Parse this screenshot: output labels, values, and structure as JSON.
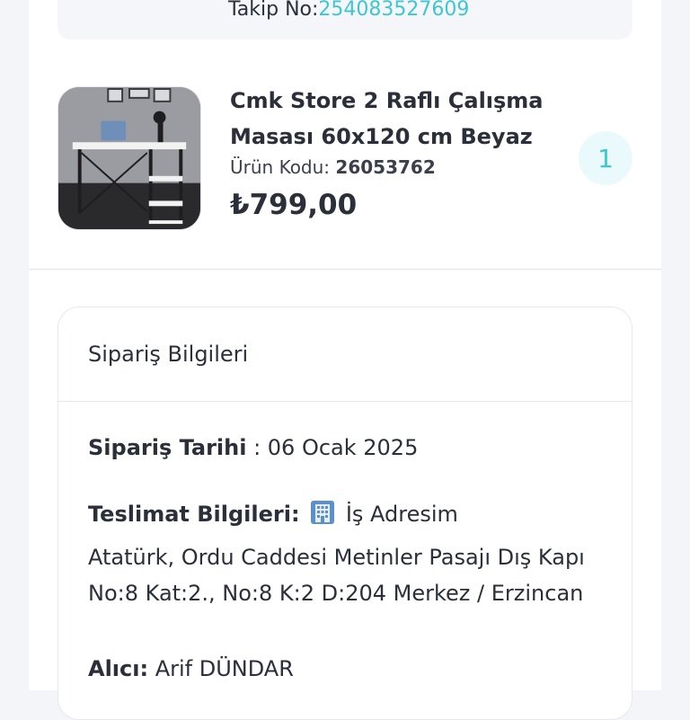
{
  "tracking": {
    "label": "Takip No:",
    "number": "254083527609"
  },
  "product": {
    "title": "Cmk Store 2 Raflı Çalışma Masası 60x120 cm Beyaz",
    "code_label": "Ürün Kodu:",
    "code_value": "26053762",
    "price": "₺799,00",
    "quantity": "1",
    "image_icon": "desk-product-image"
  },
  "order_info": {
    "header": "Sipariş Bilgileri",
    "date_label": "Sipariş Tarihi",
    "date_separator": " : ",
    "date_value": "06 Ocak 2025",
    "delivery_label": "Teslimat Bilgileri:",
    "delivery_icon": "building-icon",
    "delivery_address_name": "İş Adresim",
    "address": "Atatürk, Ordu Caddesi Metinler Pasajı Dış Kapı No:8 Kat:2., No:8 K:2 D:204 Merkez / Erzincan",
    "recipient_label": "Alıcı:",
    "recipient_name": "Arif DÜNDAR"
  },
  "colors": {
    "accent": "#3ec6d2",
    "text": "#2b2f3a",
    "border": "#e6e8ee"
  }
}
